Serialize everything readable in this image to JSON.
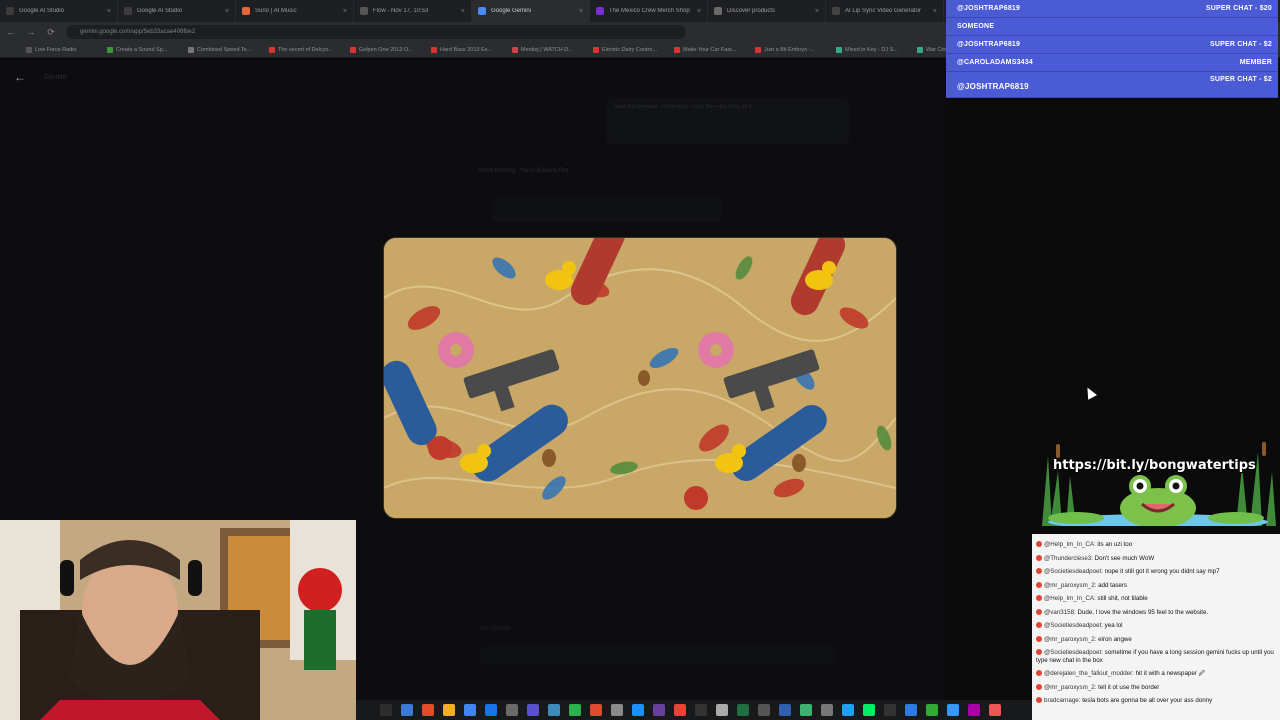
{
  "browser": {
    "tabs": [
      {
        "title": "Google AI Studio",
        "color": "#3c3c3c",
        "active": false
      },
      {
        "title": "Google AI Studio",
        "color": "#3c3c3c",
        "active": false
      },
      {
        "title": "Suno | AI Music",
        "color": "#e2683c",
        "active": false
      },
      {
        "title": "Flow - Nov 17, 10:53",
        "color": "#555",
        "active": false
      },
      {
        "title": "Google Gemini",
        "color": "#4a8af4",
        "active": true
      },
      {
        "title": "The Mexico Crew Merch Shop",
        "color": "#7b2fd0",
        "active": false
      },
      {
        "title": "Discover products",
        "color": "#6a6a6a",
        "active": false
      },
      {
        "title": "AI Lip Sync Video Generator",
        "color": "#444",
        "active": false
      }
    ],
    "url": "gemini.google.com/app/5eb33acae406fbe2",
    "bookmarks": [
      {
        "label": "Low Force Radio",
        "color": "#555"
      },
      {
        "label": "Create a Sound Sp...",
        "color": "#3a9a3a"
      },
      {
        "label": "Combined Speed Te...",
        "color": "#777"
      },
      {
        "label": "The secret of Delcyo...",
        "color": "#d33"
      },
      {
        "label": "Gelpen One 2013 O...",
        "color": "#d33"
      },
      {
        "label": "Hard Bass 2013 Es...",
        "color": "#d33"
      },
      {
        "label": "Mentioj | WATCH D...",
        "color": "#c44"
      },
      {
        "label": "Electric Dairy Contro...",
        "color": "#d33"
      },
      {
        "label": "Make Your Car Fast...",
        "color": "#d33"
      },
      {
        "label": "Just a Bit Embryo -...",
        "color": "#d33"
      },
      {
        "label": "Mixed in Key - DJ S...",
        "color": "#3a8"
      },
      {
        "label": "War Crimes - Imgur",
        "color": "#3a8"
      }
    ]
  },
  "app": {
    "title": "Gemini",
    "ghost_prompt": "make that an image, it's fine what i need, the entire thing. do it",
    "ghost_model": "Show thinking  ·  Nano Banana Pro",
    "ghost_footer": "Ask Gemini",
    "hero_alt": "Generated pattern image"
  },
  "super_chats": [
    {
      "name": "@JOSHTRAP6819",
      "tag": "SUPER CHAT - $20"
    },
    {
      "name": "SOMEONE",
      "tag": ""
    },
    {
      "name": "@JOSHTRAP6819",
      "tag": "SUPER CHAT - $2"
    },
    {
      "name": "@CAROLADAMS3434",
      "tag": "MEMBER"
    },
    {
      "name": "@JOSHTRAP6819",
      "tag": "SUPER CHAT - $2"
    }
  ],
  "promo": {
    "link": "https://bit.ly/bongwatertips"
  },
  "chat": [
    {
      "author": "@Help_Im_In_CA:",
      "text": "its an uzi too"
    },
    {
      "author": "@Thunderclese3:",
      "text": "Don't see much WoW"
    },
    {
      "author": "@Societiesdeadpoet:",
      "text": "nope it still got it wrong you didnt say mp7"
    },
    {
      "author": "@mr_paroxysm_2:",
      "text": "add tasers"
    },
    {
      "author": "@Help_Im_In_CA:",
      "text": "still shit, not tilable"
    },
    {
      "author": "@van3158:",
      "text": "Dude, I love the windows 95 feel to the website."
    },
    {
      "author": "@Societiesdeadpoet:",
      "text": "yea lol"
    },
    {
      "author": "@mr_paroxysm_2:",
      "text": "elron angwe"
    },
    {
      "author": "@Societiesdeadpoet:",
      "text": "sometime if you have a long session gemini fucks up until you type new chat in the box"
    },
    {
      "author": "@derejalen_the_fallout_modder:",
      "text": "hit it with a newspaper 🖉"
    },
    {
      "author": "@mr_paroxysm_2:",
      "text": "tell it ot use the border"
    },
    {
      "author": "bradcarnage:",
      "text": "tesla bots are gonna be all over your ass donny"
    }
  ]
}
